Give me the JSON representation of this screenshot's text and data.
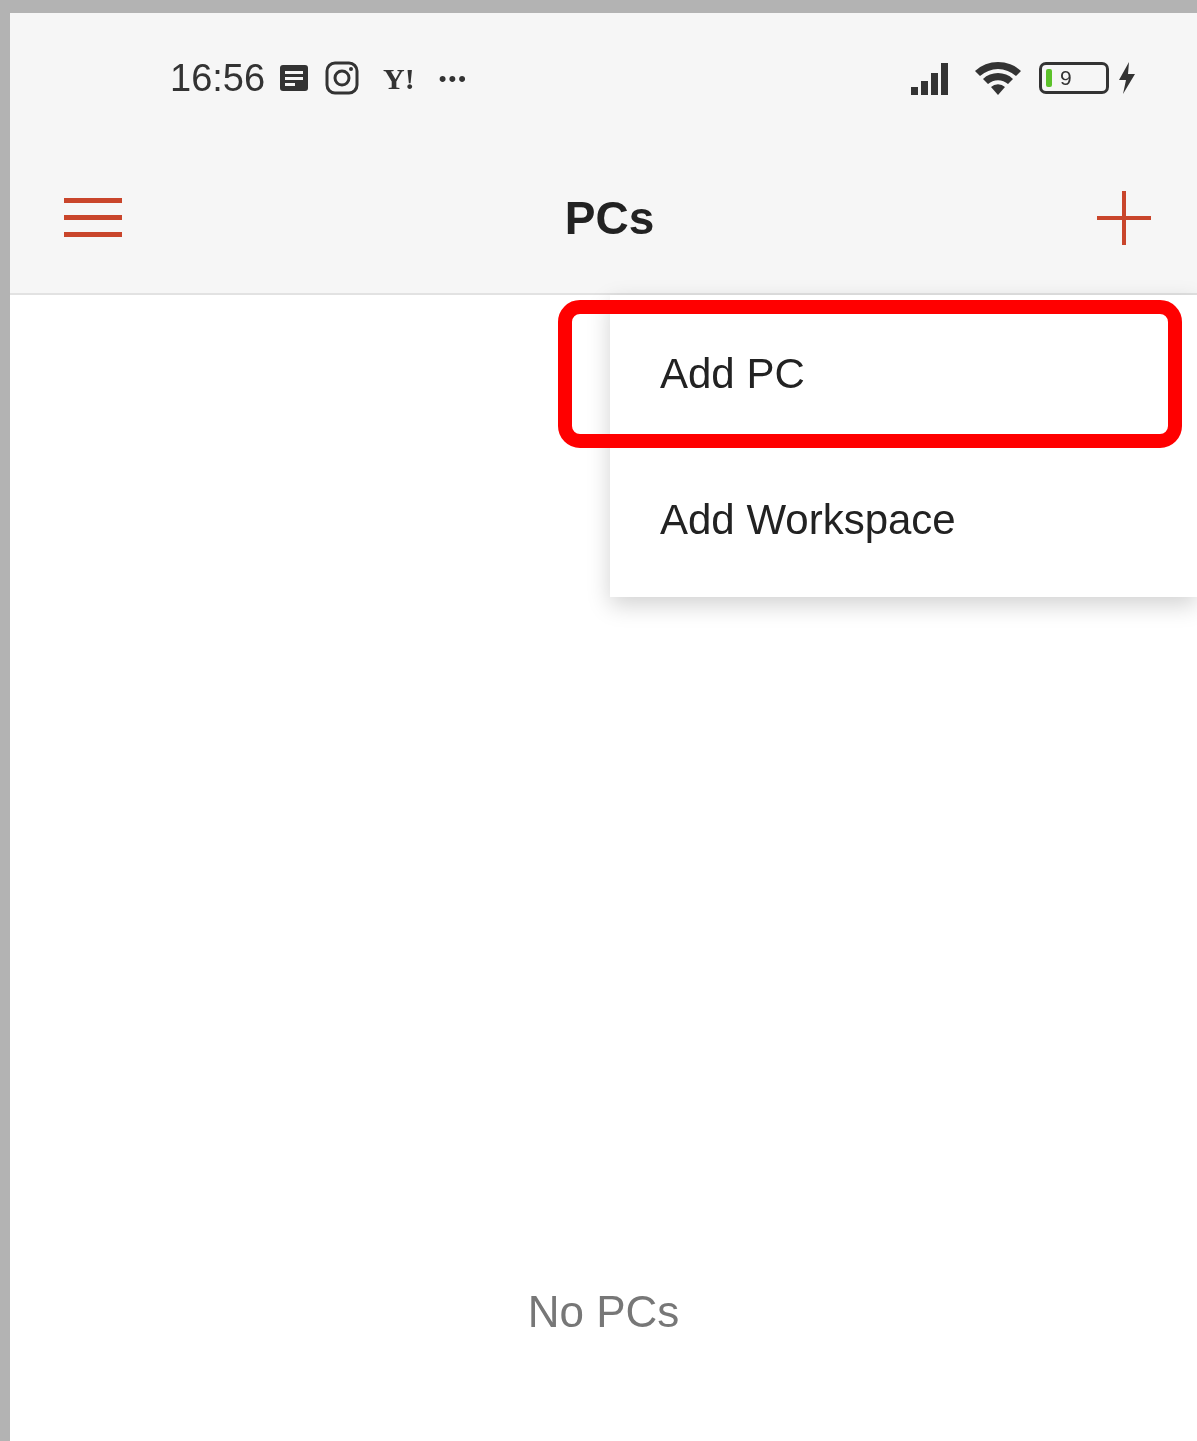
{
  "status_bar": {
    "time": "16:56",
    "app_badge": "Y!",
    "more": "•••",
    "battery": "9",
    "charging": true
  },
  "app_bar": {
    "title": "PCs"
  },
  "menu": {
    "items": [
      {
        "label": "Add PC",
        "highlighted": true
      },
      {
        "label": "Add Workspace",
        "highlighted": false
      }
    ]
  },
  "empty_state": "No PCs"
}
